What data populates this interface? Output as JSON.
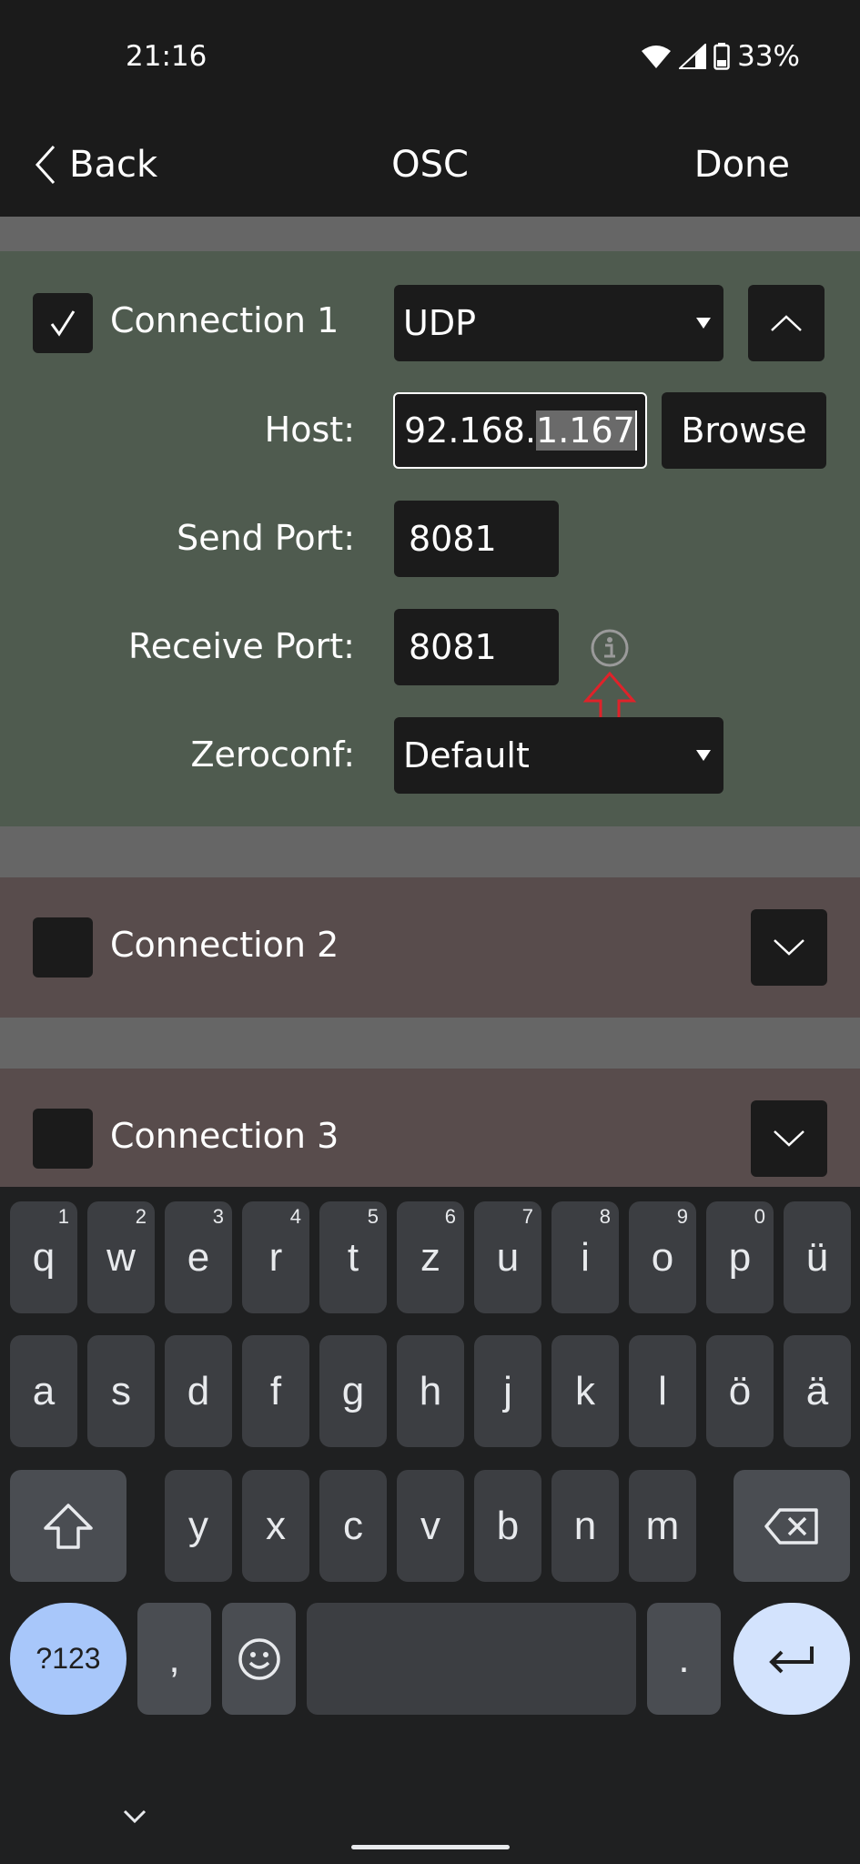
{
  "status": {
    "time": "21:16",
    "battery": "33%"
  },
  "nav": {
    "back_label": "Back",
    "title": "OSC",
    "done_label": "Done"
  },
  "connections": [
    {
      "label": "Connection 1",
      "checked": true,
      "protocol": "UDP",
      "host_label": "Host:",
      "host_value_prefix": "92.168.",
      "host_value_selected": "1.167",
      "browse_label": "Browse",
      "send_port_label": "Send Port:",
      "send_port_value": "8081",
      "receive_port_label": "Receive Port:",
      "receive_port_value": "8081",
      "zeroconf_label": "Zeroconf:",
      "zeroconf_value": "Default"
    },
    {
      "label": "Connection 2",
      "checked": false
    },
    {
      "label": "Connection 3",
      "checked": false
    }
  ],
  "keyboard": {
    "row1": [
      {
        "k": "q",
        "s": "1"
      },
      {
        "k": "w",
        "s": "2"
      },
      {
        "k": "e",
        "s": "3"
      },
      {
        "k": "r",
        "s": "4"
      },
      {
        "k": "t",
        "s": "5"
      },
      {
        "k": "z",
        "s": "6"
      },
      {
        "k": "u",
        "s": "7"
      },
      {
        "k": "i",
        "s": "8"
      },
      {
        "k": "o",
        "s": "9"
      },
      {
        "k": "p",
        "s": "0"
      },
      {
        "k": "ü",
        "s": ""
      }
    ],
    "row2": [
      "a",
      "s",
      "d",
      "f",
      "g",
      "h",
      "j",
      "k",
      "l",
      "ö",
      "ä"
    ],
    "row3": [
      "y",
      "x",
      "c",
      "v",
      "b",
      "n",
      "m"
    ],
    "symbols_label": "?123",
    "comma_label": ",",
    "period_label": "."
  },
  "colors": {
    "accent_red": "#e0222a",
    "enter_key_bg": "#d3e3fd",
    "symbols_key_bg": "#a8c7fa"
  }
}
